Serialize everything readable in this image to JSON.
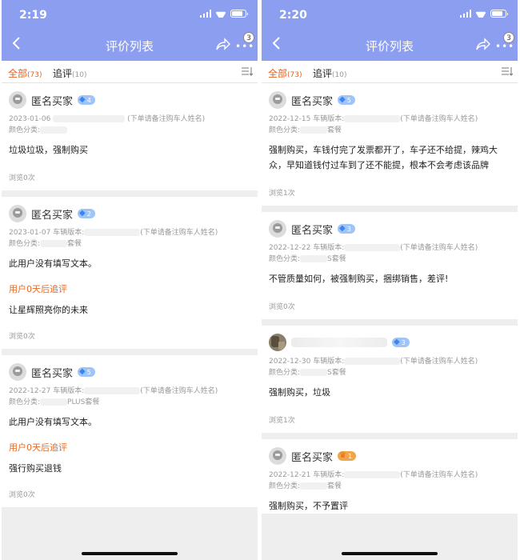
{
  "panels": [
    {
      "time": "2:19",
      "title": "评价列表",
      "more_badge": "3",
      "tabs": {
        "all": "全部",
        "all_count": "(73)",
        "follow": "追评",
        "follow_count": "(10)"
      },
      "reviews": [
        {
          "user": "匿名买家",
          "level": "4",
          "date": "2023-01-06",
          "version_label": "车辆版本:",
          "version_note": "(下单请备注购车人姓名)",
          "color_label": "颜色分类:",
          "color_value": "",
          "text": "垃圾垃圾，强制购买",
          "follow_label": "",
          "follow_text": "",
          "views": "浏览0次"
        },
        {
          "user": "匿名买家",
          "level": "2",
          "date": "2023-01-07",
          "version_label": "车辆版本:",
          "version_note": "(下单请备注购车人姓名)",
          "color_label": "颜色分类:",
          "color_value": "套餐",
          "text": "此用户没有填写文本。",
          "follow_label": "用户0天后追评",
          "follow_text": "让星辉照亮你的未来",
          "views": "浏览0次"
        },
        {
          "user": "匿名买家",
          "level": "5",
          "date": "2022-12-27",
          "version_label": "车辆版本:",
          "version_note": "(下单请备注购车人姓名)",
          "color_label": "颜色分类:",
          "color_value": "PLUS套餐",
          "text": "此用户没有填写文本。",
          "follow_label": "用户0天后追评",
          "follow_text": "强行购买退钱",
          "views": "浏览0次"
        }
      ]
    },
    {
      "time": "2:20",
      "title": "评价列表",
      "more_badge": "3",
      "tabs": {
        "all": "全部",
        "all_count": "(73)",
        "follow": "追评",
        "follow_count": "(10)"
      },
      "reviews": [
        {
          "user": "匿名买家",
          "level": "5",
          "date": "2022-12-15",
          "version_label": "车辆版本:",
          "version_note": "(下单请备注购车人姓名)",
          "color_label": "颜色分类:",
          "color_value": "套餐",
          "text": "强制购买，车钱付完了发票都开了，车子还不给提，辣鸡大众，早知道钱付过车到了还不能提，根本不会考虑该品牌",
          "follow_label": "",
          "follow_text": "",
          "views": "浏览1次"
        },
        {
          "user": "匿名买家",
          "level": "3",
          "date": "2022-12-22",
          "version_label": "车辆版本:",
          "version_note": "(下单请备注购车人姓名)",
          "color_label": "颜色分类:",
          "color_value": "S套餐",
          "text": "不管质量如何，被强制购买，捆绑销售，差评!",
          "follow_label": "",
          "follow_text": "",
          "views": "浏览0次"
        },
        {
          "user": "",
          "level": "3",
          "date": "2022-12-30",
          "version_label": "车辆版本:",
          "version_note": "(下单请备注购车人姓名)",
          "color_label": "颜色分类:",
          "color_value": "S套餐",
          "text": "强制购买，垃圾",
          "follow_label": "",
          "follow_text": "",
          "views": "浏览1次"
        },
        {
          "user": "匿名买家",
          "level": "1",
          "date": "2022-12-21",
          "version_label": "车辆版本:",
          "version_note": "(下单请备注购车人姓名)",
          "color_label": "颜色分类:",
          "color_value": "套餐",
          "text": "强制购买，不予置评",
          "follow_label": "",
          "follow_text": "",
          "views": ""
        }
      ]
    }
  ]
}
